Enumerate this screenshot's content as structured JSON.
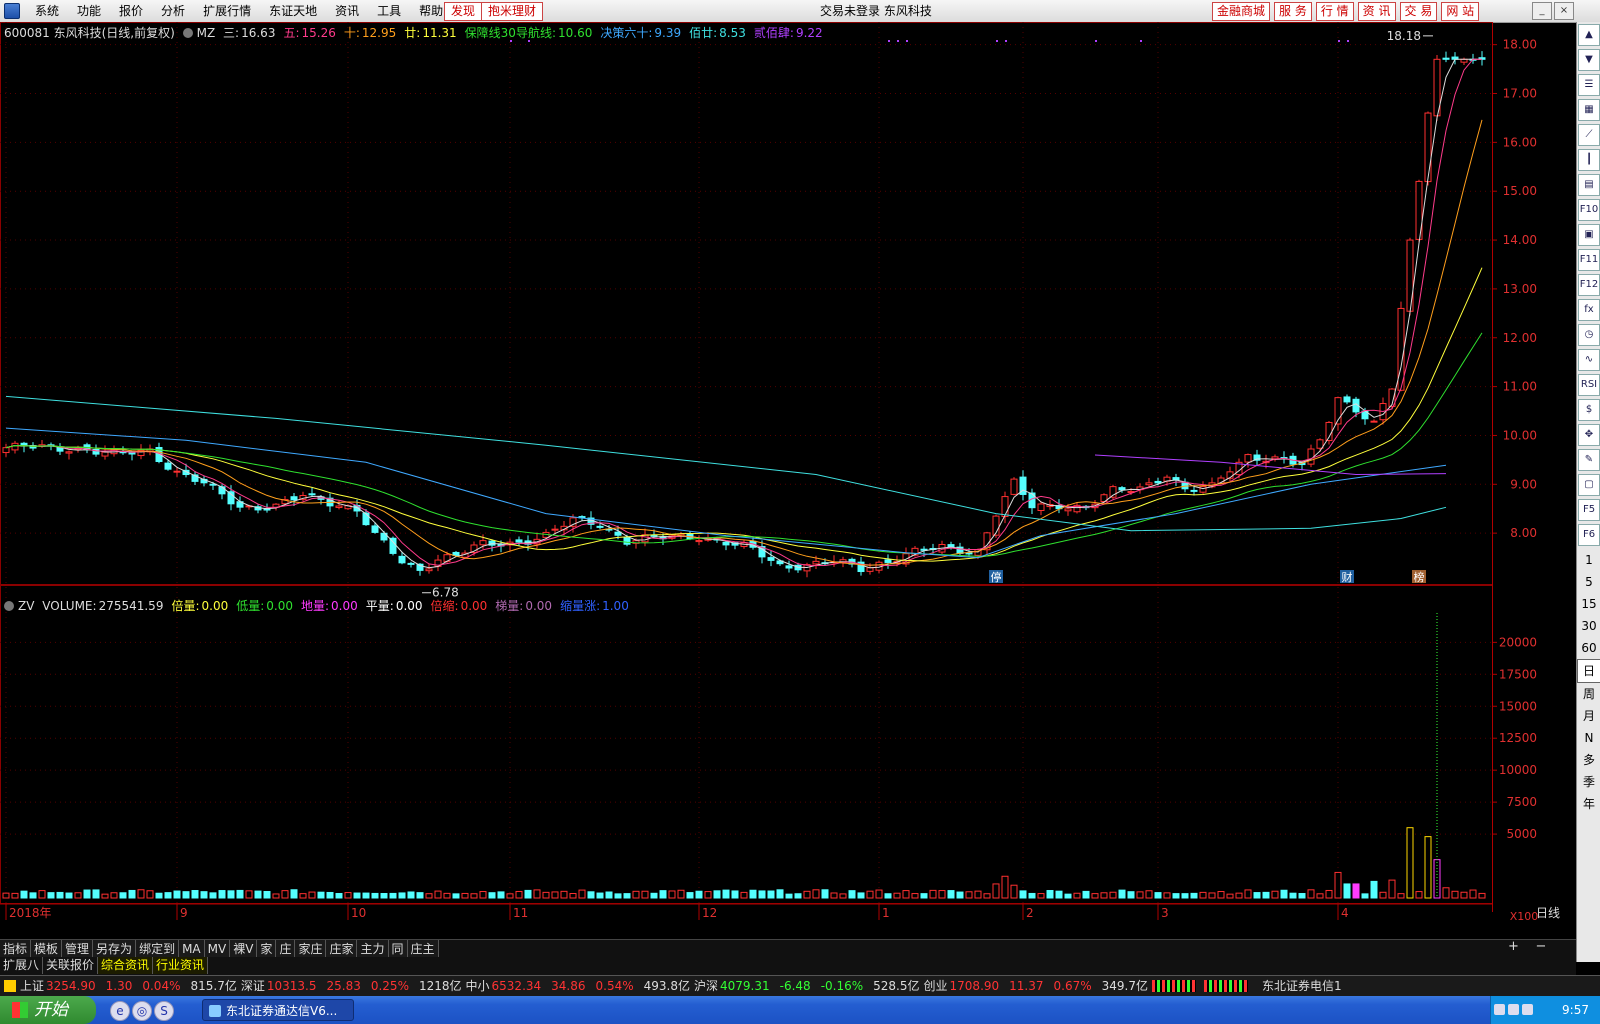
{
  "menubar": {
    "items": [
      "系统",
      "功能",
      "报价",
      "分析",
      "扩展行情",
      "东证天地",
      "资讯",
      "工具",
      "帮助"
    ],
    "discover": "发现",
    "mili": "抱米理财",
    "login_status": "交易未登录  东风科技",
    "right_buttons": [
      "金融商城",
      "服 务",
      "行 情",
      "资 讯",
      "交 易",
      "网 站"
    ]
  },
  "price_panel": {
    "stock": "600081 东风科技(日线,前复权)",
    "indicator": "MZ",
    "legend": [
      {
        "label": "三:",
        "value": "16.63",
        "color": "#dddddd"
      },
      {
        "label": "五:",
        "value": "15.26",
        "color": "#ff3b8b"
      },
      {
        "label": "十:",
        "value": "12.95",
        "color": "#ff9f1c"
      },
      {
        "label": "廿:",
        "value": "11.31",
        "color": "#ffff3c"
      },
      {
        "label": "保障线30导航线:",
        "value": "10.60",
        "color": "#2fe02f"
      },
      {
        "label": "决策六十:",
        "value": "9.39",
        "color": "#3fa9ff"
      },
      {
        "label": "佰廿:",
        "value": "8.53",
        "color": "#3fe0e0"
      },
      {
        "label": "贰佰肆:",
        "value": "9.22",
        "color": "#b040ff"
      }
    ],
    "annotations": {
      "high": "18.18",
      "low": "6.78"
    },
    "badges": [
      "停",
      "财",
      "榜"
    ]
  },
  "volume_panel": {
    "indicator": "ZV",
    "legend": [
      {
        "label": "VOLUME:",
        "value": "275541.59",
        "color": "#dddddd"
      },
      {
        "label": "倍量:",
        "value": "0.00",
        "color": "#ffff3c"
      },
      {
        "label": "低量:",
        "value": "0.00",
        "color": "#2fe02f"
      },
      {
        "label": "地量:",
        "value": "0.00",
        "color": "#ff3bff"
      },
      {
        "label": "平量:",
        "value": "0.00",
        "color": "#ffffff"
      },
      {
        "label": "倍缩:",
        "value": "0.00",
        "color": "#ff3030"
      },
      {
        "label": "梯量:",
        "value": "0.00",
        "color": "#b06ab0"
      },
      {
        "label": "缩量涨:",
        "value": "1.00",
        "color": "#3060ff"
      }
    ],
    "scale_note": "X100"
  },
  "chart_data": {
    "type": "candlestick",
    "price_axis_ticks": [
      "18.00",
      "17.00",
      "16.00",
      "15.00",
      "14.00",
      "13.00",
      "12.00",
      "11.00",
      "10.00",
      "9.00",
      "8.00"
    ],
    "price_range": [
      7.0,
      18.3
    ],
    "volume_axis_ticks": [
      "20000",
      "17500",
      "15000",
      "12500",
      "10000",
      "7500",
      "5000"
    ],
    "volume_range": [
      0,
      23000
    ],
    "time_labels": [
      "2018年",
      "9",
      "10",
      "11",
      "12",
      "1",
      "2",
      "3",
      "4"
    ],
    "time_label_index": [
      0,
      19,
      38,
      56,
      77,
      97,
      113,
      128,
      148
    ],
    "periodLabel": "日线",
    "series": [
      {
        "name": "三",
        "color": "#dddddd",
        "last": 16.63
      },
      {
        "name": "五",
        "color": "#ff3b8b",
        "last": 15.26
      },
      {
        "name": "十",
        "color": "#ff9f1c",
        "last": 12.95
      },
      {
        "name": "廿",
        "color": "#ffff3c",
        "last": 11.31
      },
      {
        "name": "保障线30导航线",
        "color": "#2fe02f",
        "last": 10.6
      },
      {
        "name": "决策六十",
        "color": "#3fa9ff",
        "last": 9.39
      },
      {
        "name": "佰廿",
        "color": "#3fe0e0",
        "last": 8.53
      },
      {
        "name": "贰佰肆",
        "color": "#b040ff",
        "last": 9.22
      }
    ],
    "anchors": [
      [
        0,
        9.75
      ],
      [
        8,
        9.75
      ],
      [
        12,
        9.6
      ],
      [
        16,
        9.7
      ],
      [
        19,
        9.25
      ],
      [
        22,
        9.0
      ],
      [
        26,
        8.55
      ],
      [
        30,
        8.55
      ],
      [
        33,
        8.75
      ],
      [
        36,
        8.65
      ],
      [
        39,
        8.5
      ],
      [
        41,
        7.95
      ],
      [
        44,
        7.4
      ],
      [
        46,
        7.25
      ],
      [
        48,
        7.5
      ],
      [
        50,
        7.55
      ],
      [
        53,
        7.75
      ],
      [
        56,
        7.8
      ],
      [
        60,
        7.95
      ],
      [
        63,
        8.25
      ],
      [
        66,
        8.2
      ],
      [
        69,
        7.85
      ],
      [
        73,
        7.9
      ],
      [
        77,
        7.95
      ],
      [
        80,
        7.8
      ],
      [
        83,
        7.65
      ],
      [
        86,
        7.35
      ],
      [
        89,
        7.35
      ],
      [
        92,
        7.4
      ],
      [
        95,
        7.28
      ],
      [
        98,
        7.45
      ],
      [
        101,
        7.6
      ],
      [
        104,
        7.7
      ],
      [
        108,
        7.65
      ],
      [
        110,
        8.4
      ],
      [
        112,
        9.0
      ],
      [
        114,
        8.55
      ],
      [
        117,
        8.6
      ],
      [
        120,
        8.5
      ],
      [
        123,
        8.85
      ],
      [
        126,
        8.95
      ],
      [
        129,
        9.2
      ],
      [
        131,
        8.85
      ],
      [
        134,
        8.95
      ],
      [
        136,
        9.35
      ],
      [
        138,
        9.6
      ],
      [
        140,
        9.5
      ],
      [
        142,
        9.45
      ],
      [
        144,
        9.4
      ],
      [
        146,
        9.95
      ],
      [
        148,
        10.8
      ],
      [
        150,
        10.5
      ],
      [
        152,
        10.2
      ],
      [
        154,
        10.95
      ],
      [
        155,
        12.6
      ],
      [
        156,
        14.0
      ],
      [
        157,
        15.2
      ],
      [
        158,
        16.6
      ],
      [
        159,
        17.7
      ]
    ],
    "volume_spikes": [
      [
        110,
        1.1
      ],
      [
        111,
        1.7
      ],
      [
        112,
        1.0
      ],
      [
        148,
        2.0
      ],
      [
        149,
        1.1
      ],
      [
        150,
        1.1
      ],
      [
        152,
        1.3
      ],
      [
        154,
        1.4
      ],
      [
        156,
        5.5
      ],
      [
        158,
        4.8
      ],
      [
        159,
        3.0
      ],
      [
        160,
        0.8
      ]
    ]
  },
  "right_toolbar": {
    "icons": [
      "arrow-up-icon",
      "arrow-down-icon",
      "list-icon",
      "grid-icon",
      "line-chart-icon",
      "candle-icon",
      "table-icon",
      "f10-icon",
      "calc-icon",
      "f11-icon",
      "f12-icon",
      "fx-icon",
      "clock-icon",
      "wave-icon",
      "rsi-icon",
      "money-icon",
      "move-icon",
      "pencil-icon",
      "doc-icon",
      "f5-icon",
      "f6-icon"
    ],
    "labels": [
      "",
      "",
      "",
      "",
      "",
      "",
      "",
      "F10",
      "",
      "F11",
      "F12",
      "fx",
      "",
      "",
      "RSI",
      "",
      "",
      "",
      "",
      "F5",
      "F6"
    ],
    "periods": [
      "1",
      "5",
      "15",
      "30",
      "60",
      "日",
      "周",
      "月",
      "N",
      "多",
      "季",
      "年"
    ]
  },
  "bottom_tabs": [
    "指标",
    "模板",
    "管理",
    "另存为",
    "绑定到",
    "MA",
    "MV",
    "裸V",
    "家",
    "庄",
    "家庄",
    "庄家",
    "主力",
    "同",
    "庄主"
  ],
  "info_tabs": [
    "扩展八",
    "关联报价",
    "综合资讯",
    "行业资讯"
  ],
  "ticker": [
    {
      "name": "上证",
      "price": "3254.90",
      "chg": "1.30",
      "pct": "0.04%",
      "amt": "815.7亿",
      "dir": "up"
    },
    {
      "name": "深证",
      "price": "10313.5",
      "chg": "25.83",
      "pct": "0.25%",
      "amt": "1218亿",
      "dir": "up"
    },
    {
      "name": "中小",
      "price": "6532.34",
      "chg": "34.86",
      "pct": "0.54%",
      "amt": "493.8亿",
      "dir": "up"
    },
    {
      "name": "沪深",
      "price": "4079.31",
      "chg": "-6.48",
      "pct": "-0.16%",
      "amt": "528.5亿",
      "dir": "dn"
    },
    {
      "name": "创业",
      "price": "1708.90",
      "chg": "11.37",
      "pct": "0.67%",
      "amt": "349.7亿",
      "dir": "up"
    }
  ],
  "broker": "东北证券电信1",
  "taskbar": {
    "start": "开始",
    "task": "东北证券通达信V6...",
    "clock": "9:57"
  }
}
